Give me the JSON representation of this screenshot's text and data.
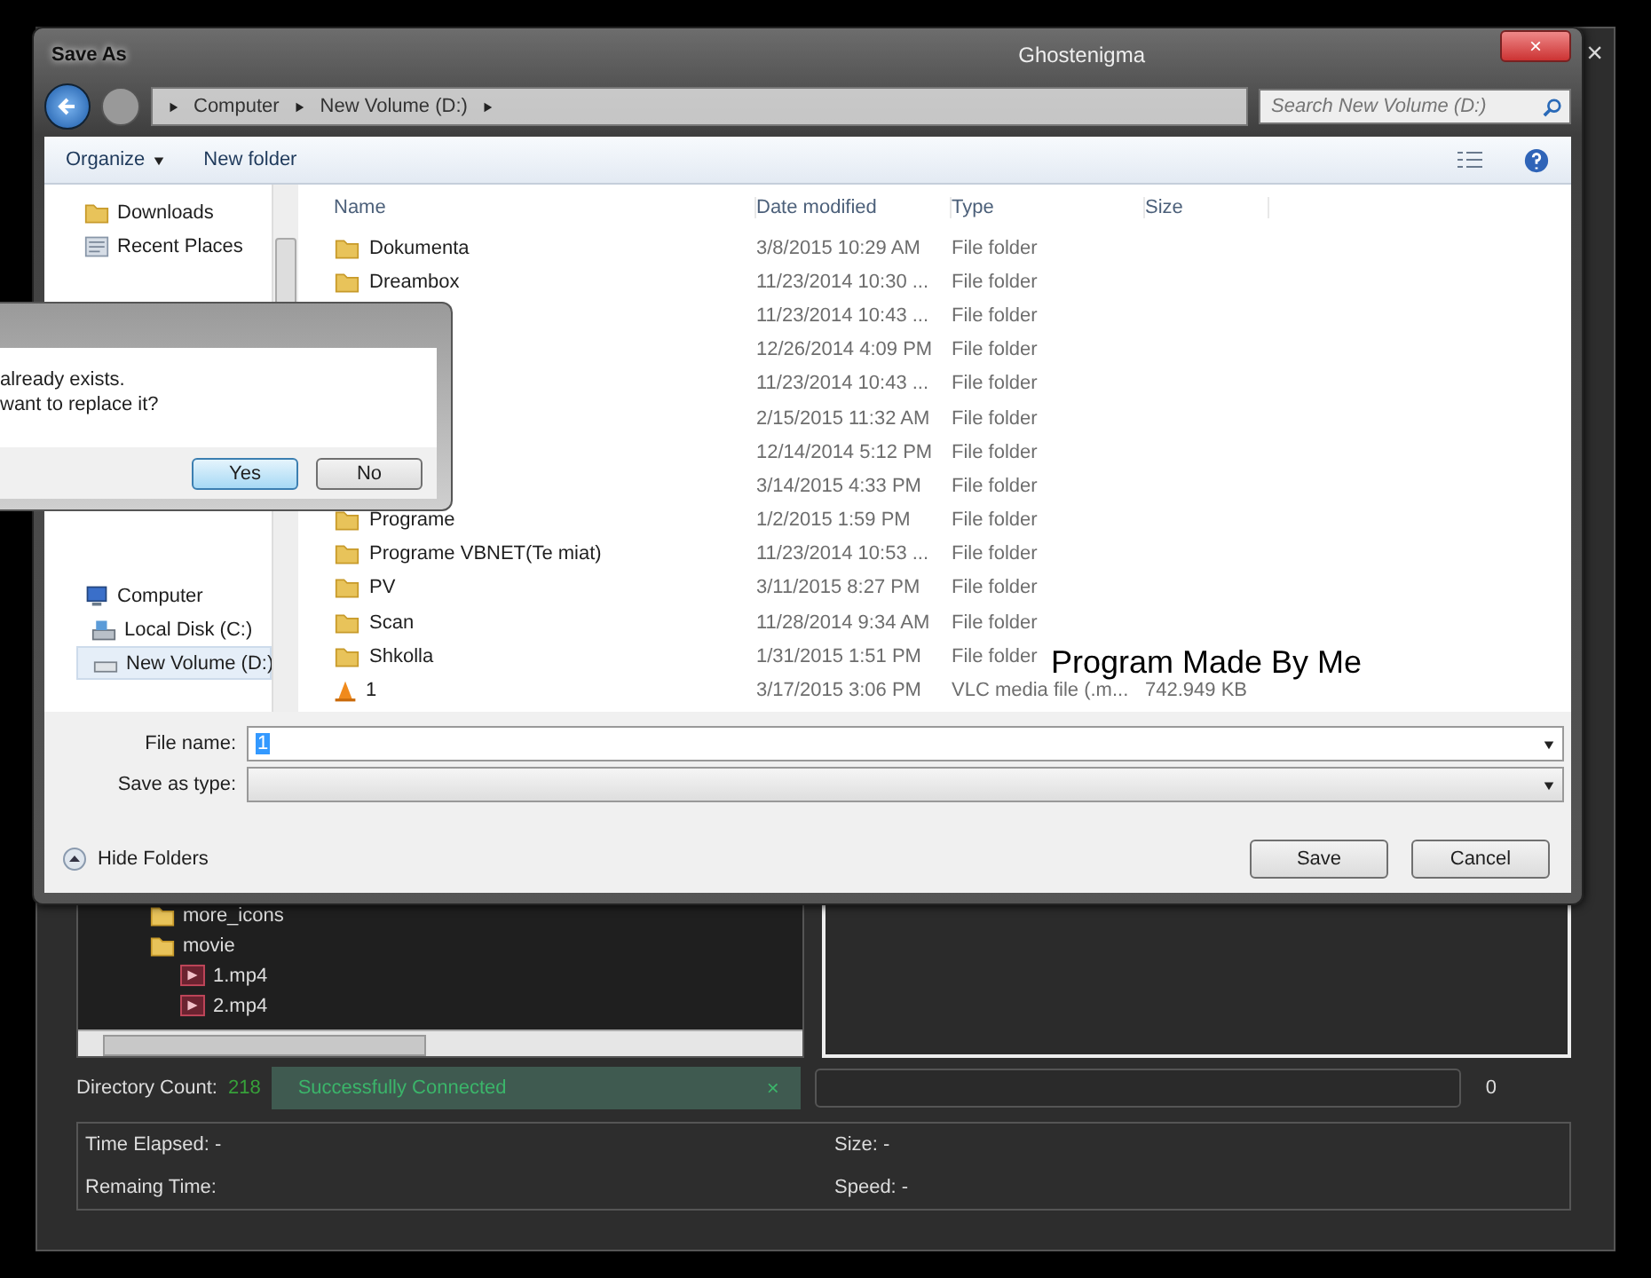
{
  "app": {
    "title": "Ghostenigma",
    "close": "×",
    "tree": [
      {
        "name": "more_icons",
        "kind": "folder"
      },
      {
        "name": "movie",
        "kind": "folder",
        "children": [
          {
            "name": "1.mp4",
            "kind": "video"
          },
          {
            "name": "2.mp4",
            "kind": "video"
          }
        ]
      }
    ],
    "directory_count_label": "Directory Count:",
    "directory_count": "218",
    "status": {
      "text": "Successfully Connected",
      "close": "×"
    },
    "progress": {
      "level": 0,
      "reading": "0"
    },
    "info": [
      {
        "label": "Time Elapsed: -"
      },
      {
        "label": "Size: -"
      },
      {
        "label": "Remaing Time:"
      },
      {
        "label": "Speed: -"
      }
    ]
  },
  "save_dialog": {
    "title": "Save As",
    "breadcrumb": [
      "Computer",
      "New Volume (D:)"
    ],
    "search": {
      "placeholder": "Search New Volume (D:)"
    },
    "toolbar": [
      {
        "label": "Organize",
        "kind": "menu"
      },
      {
        "label": "New folder",
        "kind": "button"
      }
    ],
    "nav_groups": [
      [
        {
          "label": "Downloads",
          "kind": "downloads",
          "selected": false
        },
        {
          "label": "Recent Places",
          "kind": "recent",
          "selected": false
        }
      ],
      [
        {
          "label": "Computer",
          "kind": "computer",
          "selected": false
        },
        {
          "label": "Local Disk (C:)",
          "kind": "disk",
          "selected": false
        },
        {
          "label": "New Volume (D:)",
          "kind": "drive",
          "selected": true
        }
      ]
    ],
    "columns": [
      "Name",
      "Date modified",
      "Type",
      "Size"
    ],
    "rows": [
      {
        "name": "Dokumenta",
        "kind": "folder",
        "date": "3/8/2015 10:29 AM",
        "type": "File folder"
      },
      {
        "name": "Dreambox",
        "kind": "folder",
        "date": "11/23/2014 10:30 ...",
        "type": "File folder"
      },
      {
        "date": "11/23/2014 10:43 ...",
        "type": "File folder"
      },
      {
        "date": "12/26/2014 4:09 PM",
        "type": "File folder"
      },
      {
        "date": "11/23/2014 10:43 ...",
        "type": "File folder"
      },
      {
        "date": "2/15/2015 11:32 AM",
        "type": "File folder"
      },
      {
        "date": "12/14/2014 5:12 PM",
        "type": "File folder"
      },
      {
        "date": "3/14/2015 4:33 PM",
        "type": "File folder"
      },
      {
        "name": "Programe",
        "kind": "folder",
        "date": "1/2/2015 1:59 PM",
        "type": "File folder"
      },
      {
        "name": "Programe VBNET(Te miat)",
        "kind": "folder",
        "date": "11/23/2014 10:53 ...",
        "type": "File folder"
      },
      {
        "name": "PV",
        "kind": "folder",
        "date": "3/11/2015 8:27 PM",
        "type": "File folder"
      },
      {
        "name": "Scan",
        "kind": "folder",
        "date": "11/28/2014 9:34 AM",
        "type": "File folder"
      },
      {
        "name": "Shkolla",
        "kind": "folder",
        "date": "1/31/2015 1:51 PM",
        "type": "File folder"
      },
      {
        "name": "1",
        "kind": "vlc",
        "date": "3/17/2015 3:06 PM",
        "type": "VLC media file (.m...",
        "size": "742.949 KB"
      }
    ],
    "file_name": {
      "label": "File name:",
      "value": "1"
    },
    "save_as_type": {
      "label": "Save as type:"
    },
    "hide_folders": "Hide Folders",
    "buttons": [
      "Save",
      "Cancel"
    ]
  },
  "confirm_dialog": {
    "lines": [
      "already exists.",
      "want to replace it?"
    ],
    "buttons": [
      {
        "label": "Yes",
        "selected": true
      },
      {
        "label": "No",
        "selected": false
      }
    ]
  },
  "caption": "Program Made By Me"
}
